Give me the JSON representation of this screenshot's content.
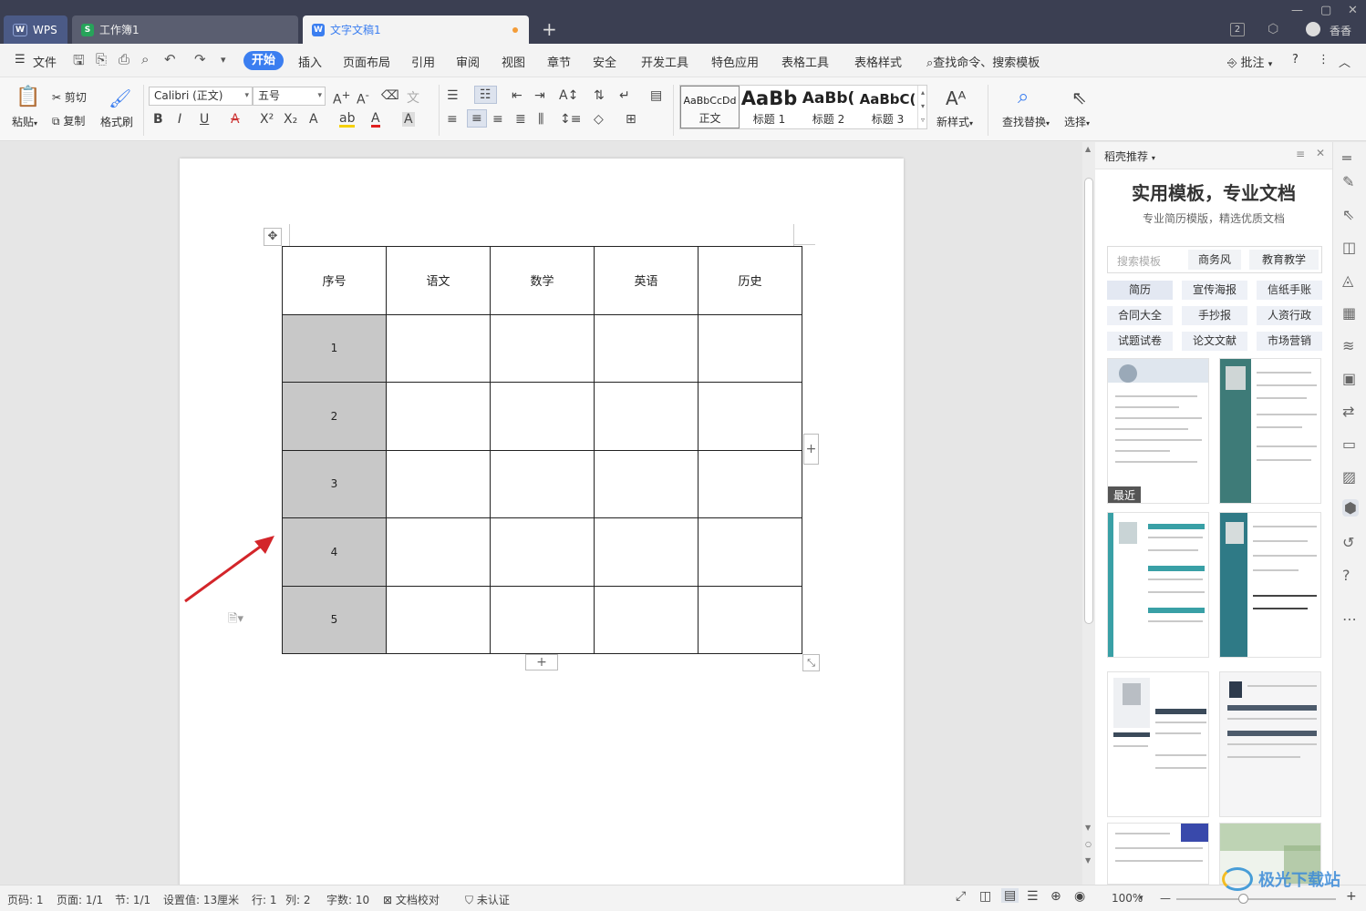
{
  "titlebar": {
    "tabs": [
      {
        "label": "WPS",
        "icon": "wps-logo-icon"
      },
      {
        "label": "工作簿1",
        "icon": "spreadsheet-icon"
      },
      {
        "label": "文字文稿1",
        "icon": "writer-doc-icon"
      }
    ],
    "user_name": "香香",
    "badge": "2",
    "colors": {
      "bar": "#3b3f52",
      "active_tab": "#f3f3f3",
      "modified_dot": "#f39c38"
    }
  },
  "menubar": {
    "file": "文件",
    "items": [
      "开始",
      "插入",
      "页面布局",
      "引用",
      "审阅",
      "视图",
      "章节",
      "安全",
      "开发工具",
      "特色应用",
      "表格工具",
      "表格样式"
    ],
    "search": "查找命令、搜索模板",
    "annotate": "批注",
    "colors": {
      "start_pill": "#3b7ef0"
    }
  },
  "ribbon": {
    "paste": "粘贴",
    "cut": "剪切",
    "copy": "复制",
    "format_painter": "格式刷",
    "font_name": "Calibri (正文)",
    "font_size": "五号",
    "styles": [
      {
        "preview": "AaBbCcDd",
        "name": "正文"
      },
      {
        "preview": "AaBb",
        "name": "标题 1"
      },
      {
        "preview": "AaBb(",
        "name": "标题 2"
      },
      {
        "preview": "AaBbC(",
        "name": "标题 3"
      }
    ],
    "new_style": "新样式",
    "find_replace": "查找替换",
    "select": "选择"
  },
  "table": {
    "headers": [
      "序号",
      "语文",
      "数学",
      "英语",
      "历史"
    ],
    "rows": [
      "1",
      "2",
      "3",
      "4",
      "5"
    ],
    "colors": {
      "index_fill": "#c8c8c8"
    }
  },
  "panel": {
    "title": "稻壳推荐",
    "headline": "实用模板，专业文档",
    "subline": "专业简历模版，精选优质文档",
    "search_placeholder": "搜索模板",
    "search_tags": [
      "商务风",
      "教育教学"
    ],
    "chips": [
      "简历",
      "宣传海报",
      "信纸手账",
      "合同大全",
      "手抄报",
      "人资行政",
      "试题试卷",
      "论文文献",
      "市场营销"
    ],
    "recent_badge": "最近"
  },
  "statusbar": {
    "page": "页码: 1",
    "pages": "页面: 1/1",
    "section": "节: 1/1",
    "setting": "设置值: 13厘米",
    "row": "行: 1",
    "col": "列: 2",
    "words": "字数: 10",
    "proof": "文档校对",
    "cert": "未认证",
    "zoom": "100%"
  },
  "watermark": "极光下载站"
}
